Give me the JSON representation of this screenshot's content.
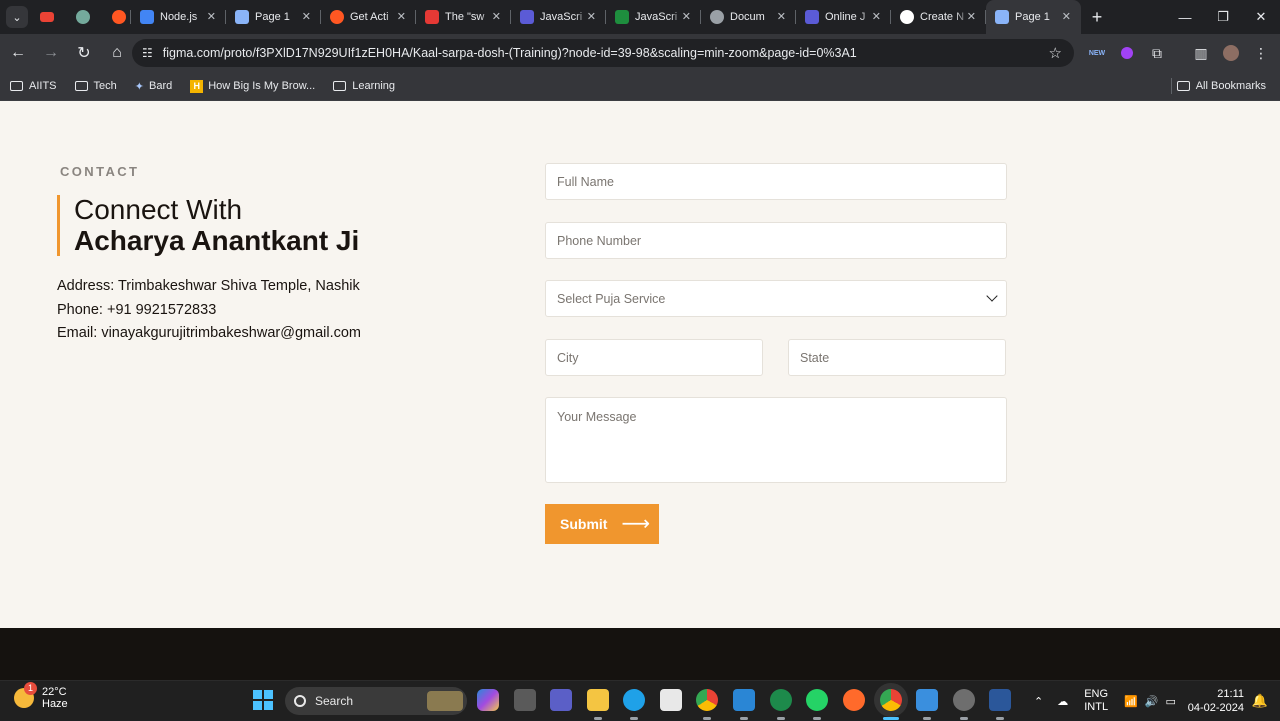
{
  "browser": {
    "tabs": [
      {
        "title": "Node.js",
        "favicon_color": "#4285f4"
      },
      {
        "title": "Page 1",
        "favicon_color": "#8ab4f8"
      },
      {
        "title": "Get Acti",
        "favicon_color": "#ff5722"
      },
      {
        "title": "The \"sw",
        "favicon_color": "#e53935"
      },
      {
        "title": "JavaScri",
        "favicon_color": "#5b5bd6"
      },
      {
        "title": "JavaScri",
        "favicon_color": "#1e8e3e"
      },
      {
        "title": "Docum",
        "favicon_color": "#9aa0a6"
      },
      {
        "title": "Online J",
        "favicon_color": "#5b5bd6"
      },
      {
        "title": "Create N",
        "favicon_color": "#ffffff"
      },
      {
        "title": "Page 1",
        "favicon_color": "#8ab4f8"
      }
    ],
    "active_tab_index": 9,
    "url": "figma.com/proto/f3PXlD17N929UIf1zEH0HA/Kaal-sarpa-dosh-(Training)?node-id=39-98&scaling=min-zoom&page-id=0%3A1",
    "bookmarks": [
      "AIITS",
      "Tech",
      "Bard",
      "How Big Is My Brow...",
      "Learning"
    ],
    "all_bookmarks_label": "All Bookmarks"
  },
  "contact": {
    "section_label": "CONTACT",
    "heading_line1": "Connect With",
    "heading_line2": "Acharya Anantkant Ji",
    "address": "Address: Trimbakeshwar Shiva Temple, Nashik",
    "phone": "Phone: +91 9921572833",
    "email": "Email: vinayakgurujitrimbakeshwar@gmail.com"
  },
  "form": {
    "full_name_placeholder": "Full Name",
    "phone_placeholder": "Phone Number",
    "service_placeholder": "Select Puja Service",
    "city_placeholder": "City",
    "state_placeholder": "State",
    "message_placeholder": "Your Message",
    "submit_label": "Submit",
    "accent_color": "#f0962e"
  },
  "taskbar": {
    "weather_temp": "22°C",
    "weather_desc": "Haze",
    "weather_badge": "1",
    "search_label": "Search",
    "lang_line1": "ENG",
    "lang_line2": "INTL",
    "time": "21:11",
    "date": "04-02-2024"
  }
}
